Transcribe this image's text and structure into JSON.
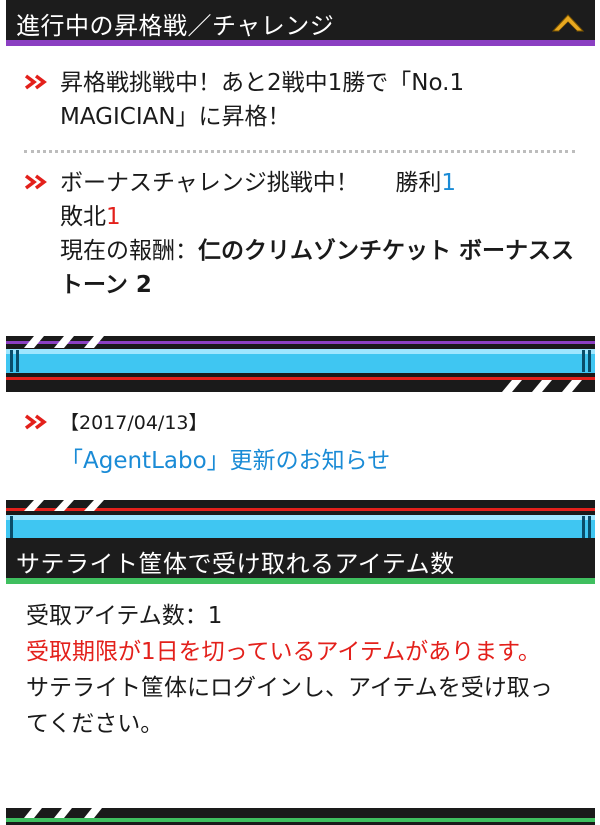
{
  "section_progress": {
    "title": "進行中の昇格戦／チャレンジ",
    "accent_color": "#8b3fc2",
    "promotion": "昇格戦挑戦中！あと2戦中1勝で「No.1 MAGICIAN」に昇格！",
    "bonus": {
      "label": "ボーナスチャレンジ挑戦中！",
      "win_label": "勝利",
      "win_count": "1",
      "lose_label": "敗北",
      "lose_count": "1",
      "reward_label": "現在の報酬：",
      "reward_value": "仁のクリムゾンチケット ボーナスストーン 2"
    }
  },
  "news": {
    "date": "【2017/04/13】",
    "link_text": "「AgentLabo」更新のお知らせ"
  },
  "section_satellite": {
    "title": "サテライト筐体で受け取れるアイテム数",
    "accent_color": "#3fbf5f",
    "count_line": "受取アイテム数：1",
    "warning": "受取期限が1日を切っているアイテムがあります。",
    "instruction": "サテライト筐体にログインし、アイテムを受け取ってください。"
  },
  "colors": {
    "link_blue": "#1a8bd6",
    "alert_red": "#e3201b",
    "banner_cyan": "#3fc6f2"
  }
}
